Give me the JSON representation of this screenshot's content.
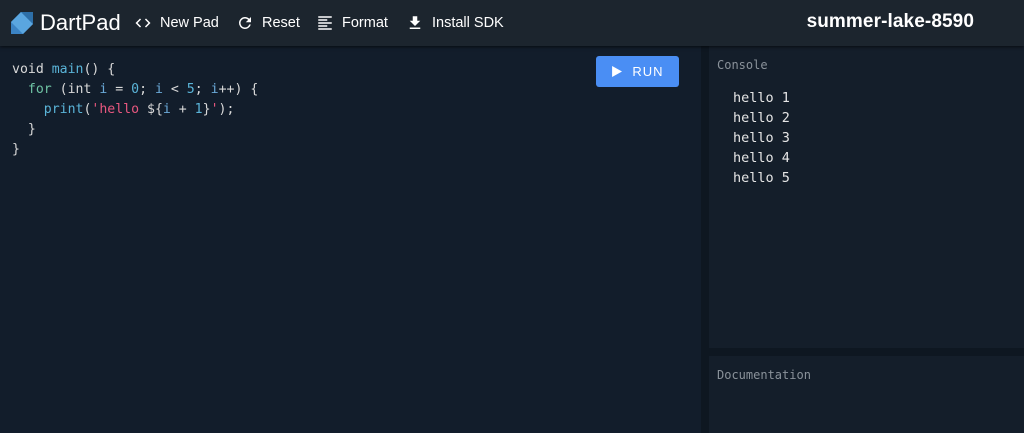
{
  "header": {
    "app_title": "DartPad",
    "new_pad": "New Pad",
    "reset": "Reset",
    "format": "Format",
    "install_sdk": "Install SDK",
    "pad_name": "summer-lake-8590"
  },
  "editor": {
    "run_label": "RUN",
    "code_lines": [
      "void main() {",
      "  for (int i = 0; i < 5; i++) {",
      "    print('hello ${i + 1}');",
      "  }",
      "}"
    ]
  },
  "console": {
    "label": "Console",
    "lines": [
      "hello 1",
      "hello 2",
      "hello 3",
      "hello 4",
      "hello 5"
    ]
  },
  "documentation": {
    "label": "Documentation"
  },
  "colors": {
    "accent": "#4a8ef4",
    "background": "#121d2b",
    "topbar": "#1c252e",
    "string": "#e8577f"
  },
  "icons": {
    "logo": "dart-logo-icon",
    "new_pad": "code-brackets-icon",
    "reset": "refresh-icon",
    "format": "format-lines-icon",
    "install_sdk": "download-icon",
    "run": "play-icon"
  }
}
